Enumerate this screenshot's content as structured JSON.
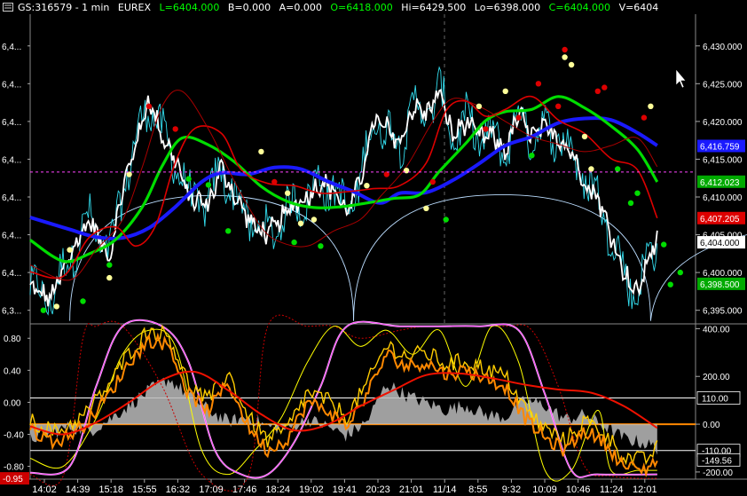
{
  "header": {
    "symbol": "GS:316579 - 1 min",
    "exchange": "EUREX",
    "last": "L=6404.000",
    "bid": "B=0.000",
    "ask": "A=0.000",
    "open": "O=6418.000",
    "high": "Hi=6429.500",
    "low": "Lo=6398.000",
    "close": "C=6404.000",
    "volume": "V=6404"
  },
  "colors": {
    "background": "#000000",
    "text": "#ffffff",
    "green_text": "#00ff00",
    "price": "#ffffff",
    "price_cyan": "#33ddee",
    "ma_blue": "#1a1aff",
    "ma_green": "#00dd00",
    "ma_red": "#dd0000",
    "ma_darkred": "#aa0000",
    "arc": "#bbddff",
    "magenta": "#ff44ff",
    "osc_yellow": "#ffff00",
    "osc_orange": "#ff8800",
    "osc_gray": "#bbbbbb",
    "hline_white": "#ffffff",
    "hline_orange": "#ff8800"
  },
  "chart_data": [
    {
      "type": "line",
      "panel": "price",
      "y_axis": {
        "ticks": [
          "6,430.000",
          "6,425.000",
          "6,420.000",
          "6,415.000",
          "6,410.000",
          "6,405.000",
          "6,400.000",
          "6,395.000"
        ],
        "tick_values": [
          6430,
          6425,
          6420,
          6415,
          6410,
          6405,
          6400,
          6395
        ],
        "ylim": [
          6393.2,
          6434.2
        ]
      },
      "left_axis_ticks": [
        "6,4...",
        "6,4...",
        "6,4...",
        "6,4...",
        "6,4...",
        "6,4...",
        "6,4...",
        "6,3..."
      ],
      "value_labels": [
        {
          "text": "6,416.759",
          "value": 6416.759,
          "color": "#1a1aff"
        },
        {
          "text": "6,412.023",
          "value": 6412.023,
          "color": "#00aa00"
        },
        {
          "text": "6,407.205",
          "value": 6407.205,
          "color": "#dd0000"
        },
        {
          "text": "6,404.000",
          "value": 6404.0,
          "color": "#ffffff"
        },
        {
          "text": "6,398.500",
          "value": 6398.5,
          "color": "#00aa00"
        }
      ],
      "reference_line": 6413.3,
      "x_ticks": [
        "14:02",
        "14:39",
        "15:18",
        "15:55",
        "16:32",
        "17:09",
        "17:46",
        "18:24",
        "19:02",
        "19:41",
        "20:23",
        "21:01",
        "11/14",
        "8:55",
        "9:32",
        "10:09",
        "10:46",
        "11:24",
        "12:01"
      ],
      "series": [
        {
          "name": "",
          "color": "#1a1aff",
          "x": [
            0,
            0.06,
            0.1,
            0.14,
            0.18,
            0.22,
            0.26,
            0.29,
            0.33,
            0.37,
            0.41,
            0.45,
            0.49,
            0.53,
            0.56,
            0.6,
            0.64,
            0.68,
            0.72,
            0.76,
            0.8,
            0.84,
            0.88,
            0.92,
            0.95
          ],
          "y": [
            6407.3,
            6405.7,
            6404.7,
            6404.6,
            6405.9,
            6408.7,
            6412,
            6413.2,
            6413,
            6413.9,
            6413.7,
            6412.1,
            6410.7,
            6409.2,
            6410.5,
            6410.6,
            6412.2,
            6414.4,
            6416.8,
            6418,
            6419.8,
            6420.4,
            6420.2,
            6418.5,
            6416.8
          ]
        },
        {
          "name": "",
          "color": "#00dd00",
          "x": [
            0,
            0.05,
            0.09,
            0.13,
            0.17,
            0.2,
            0.23,
            0.27,
            0.31,
            0.35,
            0.39,
            0.43,
            0.47,
            0.51,
            0.55,
            0.59,
            0.62,
            0.66,
            0.69,
            0.72,
            0.76,
            0.8,
            0.84,
            0.88,
            0.92,
            0.95
          ],
          "y": [
            6404.3,
            6401.5,
            6402.5,
            6404.4,
            6408.7,
            6414.1,
            6417.8,
            6416.9,
            6414.6,
            6411.4,
            6409.4,
            6408.6,
            6408.7,
            6409.2,
            6409.8,
            6410.3,
            6413.4,
            6417.1,
            6420.1,
            6421.3,
            6421.6,
            6423.3,
            6421.8,
            6419.4,
            6416.3,
            6412
          ]
        },
        {
          "name": "",
          "color": "#dd0000",
          "x": [
            0,
            0.05,
            0.09,
            0.13,
            0.16,
            0.19,
            0.22,
            0.25,
            0.29,
            0.32,
            0.36,
            0.4,
            0.44,
            0.48,
            0.52,
            0.56,
            0.6,
            0.63,
            0.66,
            0.69,
            0.72,
            0.76,
            0.8,
            0.84,
            0.88,
            0.92,
            0.95
          ],
          "y": [
            6400.1,
            6399.5,
            6404.7,
            6406,
            6403.5,
            6406.2,
            6414.6,
            6419.1,
            6418.4,
            6413.6,
            6411.8,
            6411.5,
            6410.5,
            6410.7,
            6411.1,
            6411.5,
            6414.5,
            6421.4,
            6422.7,
            6420.7,
            6421.6,
            6423.3,
            6420.2,
            6418.4,
            6415.1,
            6413.6,
            6407.2
          ]
        }
      ]
    },
    {
      "type": "line",
      "panel": "oscillator",
      "left_ticks": [
        "0.80",
        "0.40",
        "0.00",
        "-0.40",
        "-0.80"
      ],
      "left_tick_values": [
        0.8,
        0.4,
        0.0,
        -0.4,
        -0.8
      ],
      "left_ylim": [
        -0.96,
        0.98
      ],
      "left_marker": {
        "text": "-0.95",
        "value": -0.95
      },
      "right_ticks": [
        "400.00",
        "200.00",
        "0.00",
        "-200.00"
      ],
      "right_tick_values": [
        400,
        200,
        0,
        -200
      ],
      "right_ylim": [
        -230,
        420
      ],
      "right_labels": [
        {
          "text": "110.00",
          "value": 110
        },
        {
          "text": "-110.00",
          "value": -110
        },
        {
          "text": "-149.56",
          "value": -149.56
        }
      ],
      "hlines": [
        {
          "value": 110,
          "color": "#ffffff"
        },
        {
          "value": 0,
          "color": "#ff8800"
        },
        {
          "value": -110,
          "color": "#ffffff"
        }
      ]
    }
  ]
}
